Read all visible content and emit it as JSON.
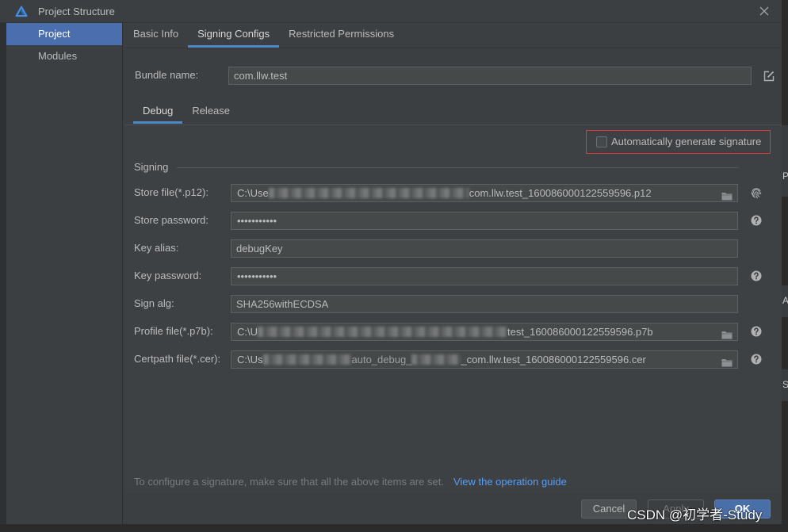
{
  "window": {
    "title": "Project Structure"
  },
  "sidebar": {
    "items": [
      {
        "label": "Project",
        "selected": true
      },
      {
        "label": "Modules",
        "selected": false
      }
    ]
  },
  "tabs": [
    {
      "label": "Basic Info",
      "selected": false
    },
    {
      "label": "Signing Configs",
      "selected": true
    },
    {
      "label": "Restricted Permissions",
      "selected": false
    }
  ],
  "bundle": {
    "label": "Bundle name:",
    "value": "com.llw.test"
  },
  "subtabs": [
    {
      "label": "Debug",
      "selected": true
    },
    {
      "label": "Release",
      "selected": false
    }
  ],
  "auto_sign": {
    "label": "Automatically generate signature",
    "checked": false
  },
  "signing": {
    "section_label": "Signing",
    "store_file": {
      "label": "Store file(*.p12):",
      "value_prefix": "C:\\Use",
      "value_suffix": "com.llw.test_160086000122559596.p12"
    },
    "store_password": {
      "label": "Store password:",
      "masked": "•••••••••••"
    },
    "key_alias": {
      "label": "Key alias:",
      "value": "debugKey"
    },
    "key_password": {
      "label": "Key password:",
      "masked": "•••••••••••"
    },
    "sign_alg": {
      "label": "Sign alg:",
      "value": "SHA256withECDSA"
    },
    "profile_file": {
      "label": "Profile file(*.p7b):",
      "value_prefix": "C:\\U",
      "value_suffix": "test_160086000122559596.p7b"
    },
    "certpath_file": {
      "label": "Certpath file(*.cer):",
      "value_prefix": "C:\\Us",
      "value_middle": "auto_debug_",
      "value_suffix": "_com.llw.test_160086000122559596.cer"
    }
  },
  "hint": {
    "text": "To configure a signature, make sure that all the above items are set.",
    "link": "View the operation guide"
  },
  "buttons": {
    "cancel": "Cancel",
    "apply": "Apply",
    "ok": "OK"
  },
  "watermark": "CSDN @初学者-Study",
  "background_fragments": [
    "P",
    "AF",
    "SI"
  ],
  "icons": {
    "app_logo": "deveco-logo-icon",
    "close": "close-icon",
    "edit": "edit-icon",
    "browse": "folder-icon",
    "fingerprint": "fingerprint-icon",
    "help": "help-icon"
  },
  "colors": {
    "window_bg": "#3c3f41",
    "selection": "#4b6eaf",
    "tab_underline": "#4a88c7",
    "highlight_box": "#e0383e",
    "link": "#589df6",
    "ok_button": "#4a6fa8"
  }
}
